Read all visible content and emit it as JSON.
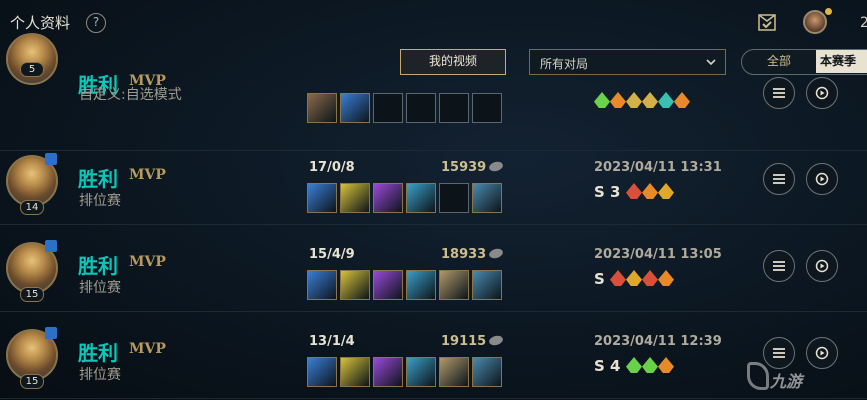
{
  "header": {
    "title": "个人资料",
    "help": "?",
    "count": "2"
  },
  "filters": {
    "videos_label": "我的视频",
    "games_select": "所有对局",
    "seg_all": "全部",
    "seg_season": "本赛季"
  },
  "matches": [
    {
      "level": "5",
      "result": "胜利",
      "mvp": "MVP",
      "mode": "自定义:自选模式",
      "kda": "",
      "gold": "",
      "date": "",
      "items": [
        "hammer",
        "spellblade",
        "empty",
        "empty",
        "empty",
        "empty"
      ],
      "badges": [
        "flag-green",
        "flame-orange",
        "swirl-gold",
        "swirl-gold",
        "shield-teal",
        "flame-orange"
      ]
    },
    {
      "level": "14",
      "result": "胜利",
      "mvp": "MVP",
      "mode": "排位赛",
      "kda": "17/0/8",
      "gold": "15939",
      "date": "2023/04/11 13:31",
      "items": [
        "spellblade",
        "triforce",
        "mage",
        "bow",
        "empty",
        "trinket"
      ],
      "badges": [
        "S",
        "3",
        "crown-red",
        "flame-orange",
        "crown-gold"
      ]
    },
    {
      "level": "15",
      "result": "胜利",
      "mvp": "MVP",
      "mode": "排位赛",
      "kda": "15/4/9",
      "gold": "18933",
      "date": "2023/04/11 13:05",
      "items": [
        "spellblade",
        "triforce",
        "mage",
        "bow",
        "dagger",
        "trinket"
      ],
      "badges": [
        "S",
        "crown-red",
        "crown-gold",
        "crown-red",
        "flame-orange"
      ]
    },
    {
      "level": "15",
      "result": "胜利",
      "mvp": "MVP",
      "mode": "排位赛",
      "kda": "13/1/4",
      "gold": "19115",
      "date": "2023/04/11 12:39",
      "items": [
        "spellblade",
        "triforce",
        "mage",
        "bow",
        "dagger",
        "trinket"
      ],
      "badges": [
        "S",
        "4",
        "flag-green",
        "flag-green",
        "flame-orange"
      ]
    }
  ],
  "watermark": "九游",
  "colors": {
    "accent_gold": "#c8aa6e",
    "victory_teal": "#0ac8b9",
    "background": "#0a1119"
  }
}
